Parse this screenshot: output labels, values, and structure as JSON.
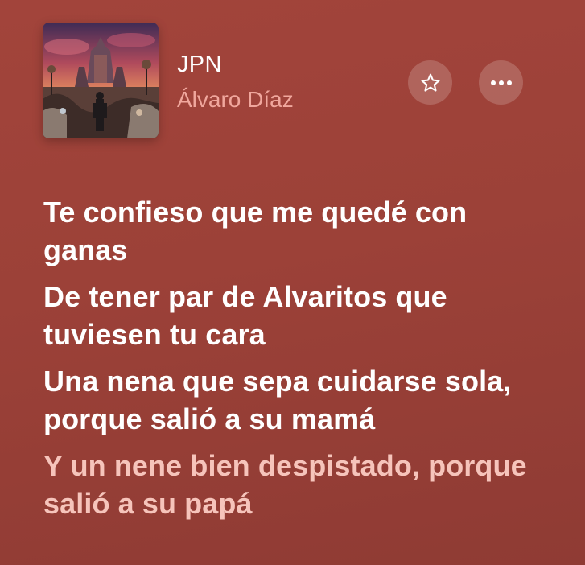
{
  "track": {
    "title": "JPN",
    "artist": "Álvaro Díaz",
    "artwork_icon": "album-artwork"
  },
  "actions": {
    "favorite_icon": "star-icon",
    "more_icon": "ellipsis-icon"
  },
  "lyrics": [
    {
      "text": "Te confieso que me quedé con ganas",
      "state": "past"
    },
    {
      "text": "De tener par de Alvaritos que tuviesen tu cara",
      "state": "past"
    },
    {
      "text": "Una nena que sepa cuidarse sola, porque salió a su mamá",
      "state": "past"
    },
    {
      "text": "Y un nene bien despistado, porque salió a su papá",
      "state": "current"
    }
  ],
  "colors": {
    "background": "#9c4138",
    "artist_text": "#f0a79d",
    "lyric_active": "#ffffff",
    "lyric_upcoming": "#f6c4bb"
  }
}
